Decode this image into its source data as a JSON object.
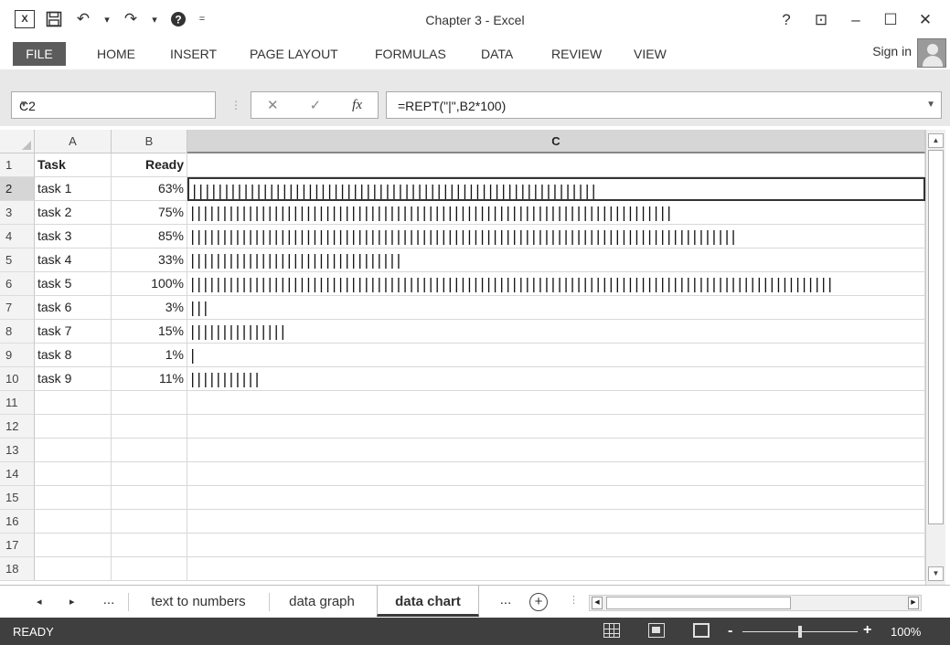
{
  "window": {
    "title": "Chapter 3 - Excel",
    "help": "?",
    "ribbon_options": "⊡",
    "minimize": "–",
    "maximize": "☐",
    "close": "✕"
  },
  "qat": {
    "excel_icon": "excel-icon",
    "save_icon": "save-icon",
    "undo": "↶",
    "redo": "↷",
    "dropdown": "▾",
    "customize": "="
  },
  "ribbon": {
    "tabs": [
      "FILE",
      "HOME",
      "INSERT",
      "PAGE LAYOUT",
      "FORMULAS",
      "DATA",
      "REVIEW",
      "VIEW"
    ],
    "sign_in": "Sign in"
  },
  "formula_bar": {
    "name_box": "C2",
    "cancel": "✕",
    "enter": "✓",
    "fx": "fx",
    "formula": "=REPT(\"|\",B2*100)"
  },
  "grid": {
    "columns": [
      "A",
      "B",
      "C"
    ],
    "rows": [
      "1",
      "2",
      "3",
      "4",
      "5",
      "6",
      "7",
      "8",
      "9",
      "10",
      "11",
      "12",
      "13",
      "14",
      "15",
      "16",
      "17",
      "18"
    ],
    "header_row": {
      "a": "Task",
      "b": "Ready"
    },
    "data": [
      {
        "a": "task 1",
        "b": "63%",
        "value": 0.63
      },
      {
        "a": "task 2",
        "b": "75%",
        "value": 0.75
      },
      {
        "a": "task 3",
        "b": "85%",
        "value": 0.85
      },
      {
        "a": "task 4",
        "b": "33%",
        "value": 0.33
      },
      {
        "a": "task 5",
        "b": "100%",
        "value": 1.0
      },
      {
        "a": "task 6",
        "b": "3%",
        "value": 0.03
      },
      {
        "a": "task 7",
        "b": "15%",
        "value": 0.15
      },
      {
        "a": "task 8",
        "b": "1%",
        "value": 0.01
      },
      {
        "a": "task 9",
        "b": "11%",
        "value": 0.11
      }
    ]
  },
  "sheets": {
    "nav_prev": "◂",
    "nav_next": "▸",
    "ellipsis_left": "...",
    "tabs": [
      "text to numbers",
      "data graph",
      "data chart"
    ],
    "active": "data chart",
    "ellipsis_right": "...",
    "add": "+"
  },
  "status": {
    "ready": "READY",
    "zoom_minus": "-",
    "zoom_plus": "+",
    "zoom": "100%"
  }
}
